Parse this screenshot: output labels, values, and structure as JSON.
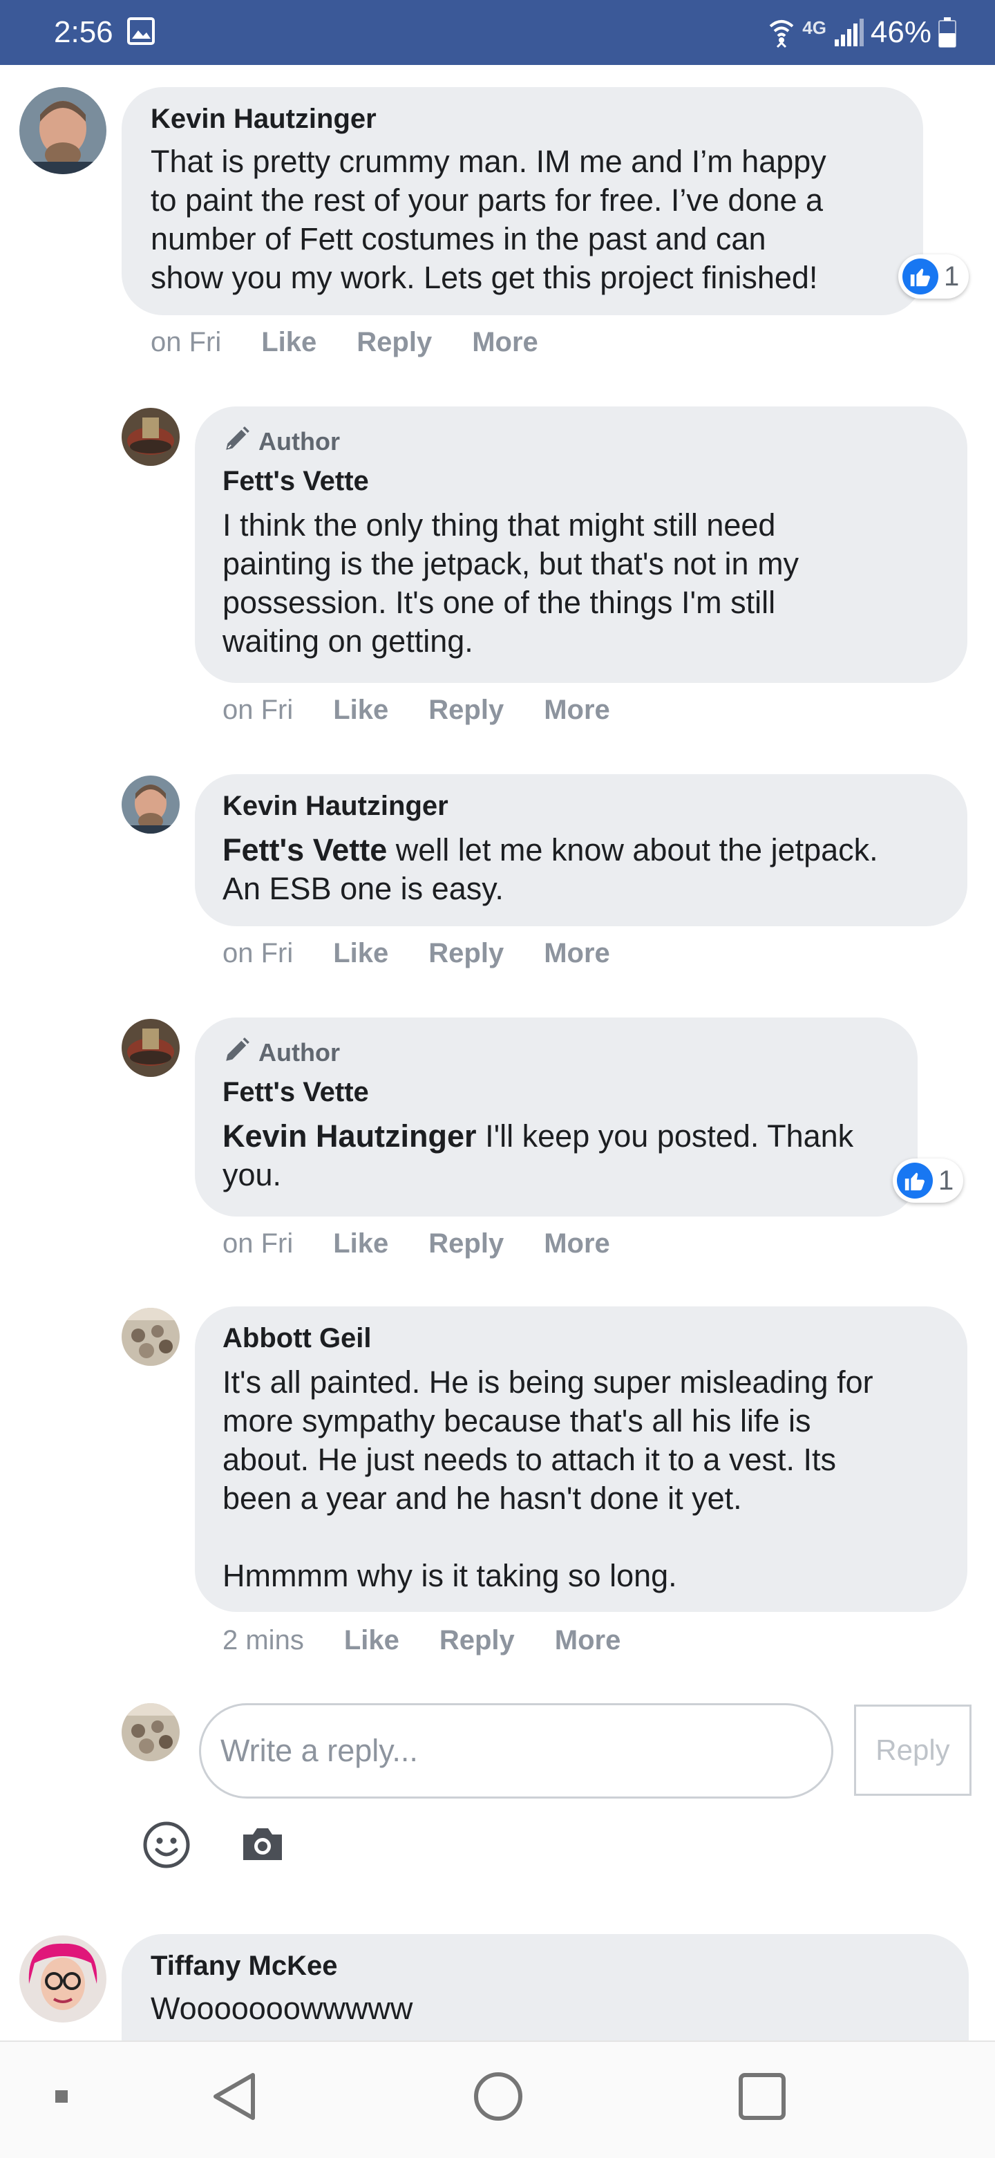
{
  "status_bar": {
    "time": "2:56",
    "network": "4G",
    "battery": "46%",
    "icons": [
      "gallery-icon",
      "wifi-icon",
      "signal-icon",
      "battery-icon"
    ]
  },
  "colors": {
    "brand": "#3b5998",
    "bubble": "#ebedf0",
    "like": "#1877f2",
    "meta": "#8d949e"
  },
  "comments": [
    {
      "name": "Kevin Hautzinger",
      "text": "That is pretty crummy man. IM me and I’m happy\nto paint the rest of your parts for free. I’ve done a\nnumber of Fett costumes in the past and can\nshow you my work. Lets get this project finished!",
      "time": "on Fri",
      "like": "Like",
      "reply": "Reply",
      "more": "More",
      "reactions": "1"
    },
    {
      "badge": "Author",
      "name": "Fett's Vette",
      "text": "I think the only thing that might still need\npainting is the jetpack, but that's not in my\npossession. It's one of the things I'm still\nwaiting on getting.",
      "time": "on Fri",
      "like": "Like",
      "reply": "Reply",
      "more": "More"
    },
    {
      "name": "Kevin Hautzinger",
      "mention": "Fett's Vette",
      "text": " well let me know about the jetpack.\nAn ESB one is easy.",
      "time": "on Fri",
      "like": "Like",
      "reply": "Reply",
      "more": "More"
    },
    {
      "badge": "Author",
      "name": "Fett's Vette",
      "mention": "Kevin Hautzinger",
      "text": " I'll keep you posted. Thank\nyou.",
      "time": "on Fri",
      "like": "Like",
      "reply": "Reply",
      "more": "More",
      "reactions": "1"
    },
    {
      "name": "Abbott Geil",
      "text": "It's all painted. He is being super misleading for\nmore sympathy because that's all his life is\nabout. He just needs to attach it to a vest. Its\nbeen a year and he hasn't done it yet.\n\nHmmmm why is it taking so long.",
      "time": "2 mins",
      "like": "Like",
      "reply": "Reply",
      "more": "More"
    },
    {
      "name": "Tiffany McKee",
      "text": "Wooooooowwwww"
    }
  ],
  "reply_box": {
    "placeholder": "Write a reply...",
    "button": "Reply",
    "icons": [
      "emoji-icon",
      "camera-icon"
    ]
  },
  "nav_bar": {
    "icons": [
      "recent-dot-icon",
      "back-icon",
      "home-icon",
      "overview-icon"
    ]
  }
}
